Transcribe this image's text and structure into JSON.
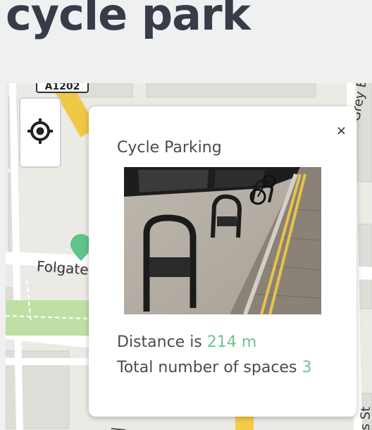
{
  "page": {
    "title": "cycle park"
  },
  "map": {
    "road_shield": "A1202",
    "street_labels": {
      "folgate": "Folgate",
      "eagle": "Grey Eagle S",
      "street_bottom": "s St"
    },
    "colors": {
      "primary_road": "#f4cd48",
      "park": "#bfe0a5",
      "pin": "#5fc48a"
    },
    "locate_button_icon": "crosshair-locate-icon"
  },
  "popup": {
    "title": "Cycle Parking",
    "close_label": "×",
    "photo_icon": "bike-rack-photo",
    "distance_label": "Distance is",
    "distance_value": "214 m",
    "spaces_label": "Total number of spaces",
    "spaces_value": "3",
    "accent_color": "#6fc48c"
  }
}
